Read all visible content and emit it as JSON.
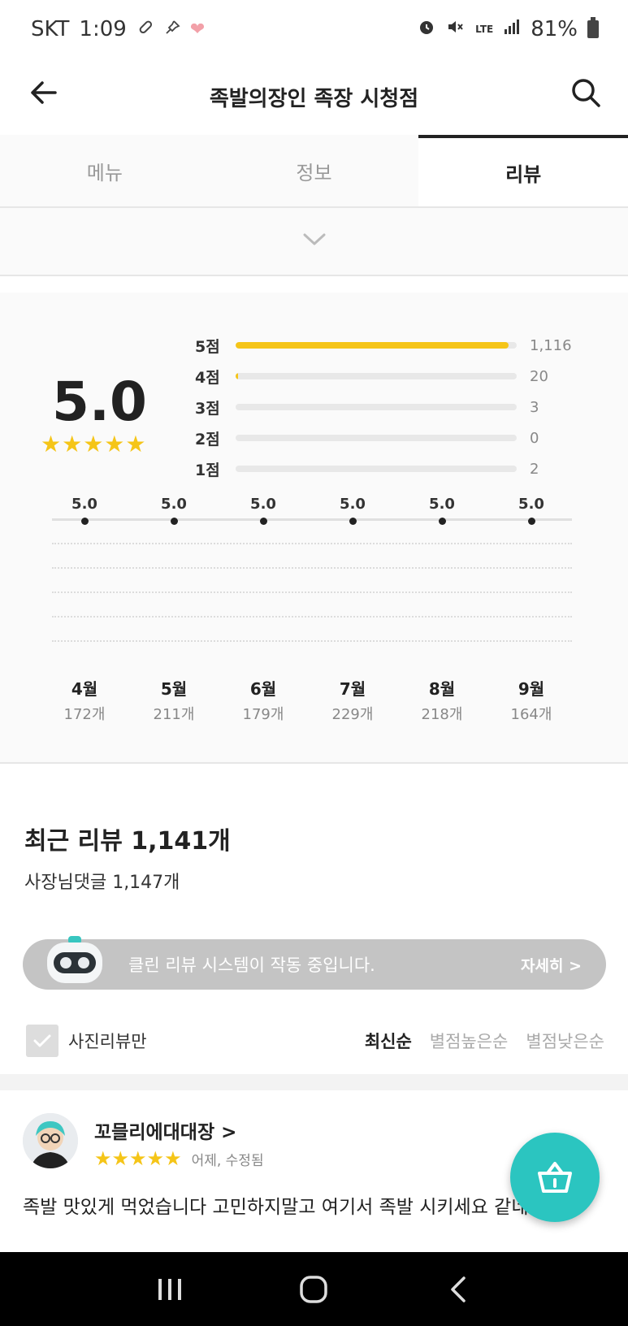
{
  "status_bar": {
    "carrier": "SKT",
    "time": "1:09",
    "network": "LTE",
    "battery": "81%"
  },
  "app_bar": {
    "title": "족발의장인 족장 시청점"
  },
  "tabs": [
    {
      "label": "메뉴"
    },
    {
      "label": "정보"
    },
    {
      "label": "리뷰",
      "active": true
    }
  ],
  "rating_summary": {
    "average": "5.0",
    "stars": "★★★★★",
    "distribution": [
      {
        "label": "5점",
        "count": "1,116",
        "fraction": 0.97
      },
      {
        "label": "4점",
        "count": "20",
        "fraction": 0.01
      },
      {
        "label": "3점",
        "count": "3",
        "fraction": 0.0
      },
      {
        "label": "2점",
        "count": "0",
        "fraction": 0.0
      },
      {
        "label": "1점",
        "count": "2",
        "fraction": 0.0
      }
    ]
  },
  "monthly_trend": [
    {
      "month": "4월",
      "rating": "5.0",
      "count": "172개"
    },
    {
      "month": "5월",
      "rating": "5.0",
      "count": "211개"
    },
    {
      "month": "6월",
      "rating": "5.0",
      "count": "179개"
    },
    {
      "month": "7월",
      "rating": "5.0",
      "count": "229개"
    },
    {
      "month": "8월",
      "rating": "5.0",
      "count": "218개"
    },
    {
      "month": "9월",
      "rating": "5.0",
      "count": "164개"
    }
  ],
  "reviews_header": {
    "title": "최근 리뷰 1,141개",
    "owner_replies": "사장님댓글 1,147개"
  },
  "clean_banner": {
    "text": "클린 리뷰 시스템이 작동 중입니다.",
    "detail": "자세히 >"
  },
  "filter": {
    "photo_only": "사진리뷰만",
    "sort_options": [
      {
        "label": "최신순",
        "active": true
      },
      {
        "label": "별점높은순"
      },
      {
        "label": "별점낮은순"
      }
    ]
  },
  "review": {
    "author": "꼬믈리에대대장 >",
    "stars": "★★★★★",
    "time": "어제, 수정됨",
    "text": "족발 맛있게 먹었습니다 고민하지말고 여기서 족발 시키세요 같네요"
  },
  "colors": {
    "accent_yellow": "#f5c518",
    "fab_teal": "#2bc5c0"
  }
}
